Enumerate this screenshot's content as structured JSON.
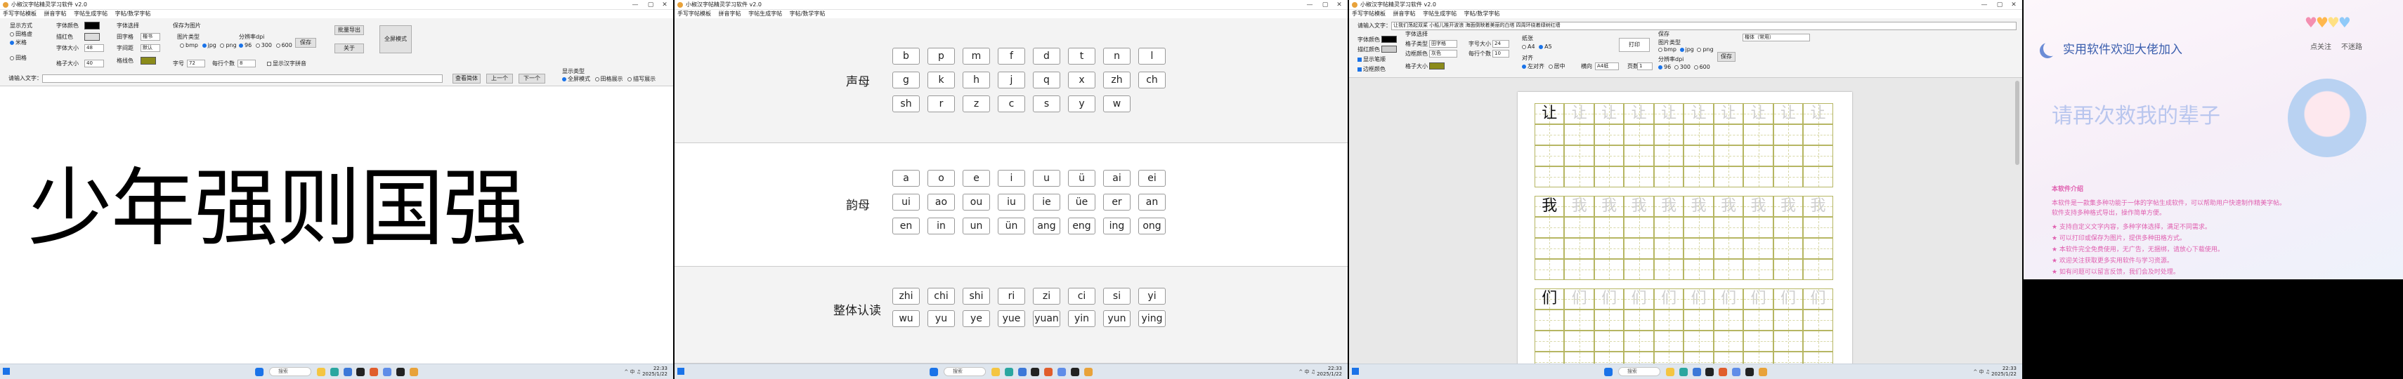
{
  "colors": {
    "accent": "#1a73e8",
    "swatch_black": "#000000",
    "swatch_olive": "#8b8b1a",
    "grid_line": "#b6b663",
    "poster_pink": "#e060b0",
    "poster_blue": "#6b8cd6"
  },
  "window": {
    "title": "小椒汉字帖精灵学习软件 v2.0",
    "min": "—",
    "max": "▢",
    "close": "✕"
  },
  "menu": [
    "手写字帖模板",
    "拼音字帖",
    "字帖生成字帖",
    "字帖/数学字帖"
  ],
  "taskbar": {
    "search": "搜索",
    "time": "22:33",
    "date": "2025/1/22",
    "tray": "^ 中 ♫"
  },
  "p1": {
    "font_style_label": "显示方式",
    "opt1": "田格虚",
    "opt2": "米格",
    "opt3": "田格",
    "opt4": "横线",
    "opt5": "方格",
    "color_label": "字体颜色",
    "border_color_label": "描红色",
    "size_label": "字体大小",
    "grid_size_label": "格子大小",
    "grid_color_label": "格线色",
    "font_label": "字体选择",
    "font_value": "楷书",
    "spacing_label": "字间距",
    "spacing_value": "默认",
    "chars_label": "字数",
    "font_size_value": "48",
    "grid_size_value": "40",
    "mode_label": "田字格",
    "trace_label": "描红数量",
    "export_label": "保存为图片",
    "fmt_label": "图片类型",
    "fmt1": "bmp",
    "fmt2": "jpg",
    "fmt3": "png",
    "res_label": "分辨率dpi",
    "res1": "96",
    "res2": "300",
    "res3": "600",
    "pages_label": "字号",
    "pages_value": "72",
    "lines_label": "每行个数",
    "lines_value": "8",
    "show_pinyin": "显示汉字拼音",
    "btn_save": "保存",
    "btn_batch": "批量导出",
    "btn_about": "关于",
    "btn_fullscreen": "全屏模式",
    "input_label": "请输入文字：",
    "input_value": "",
    "btn_search": "查看简体",
    "btn_prev": "上一个",
    "btn_next": "下一个",
    "display_label": "显示类型",
    "disp1": "全屏模式",
    "disp2": "田格展示",
    "disp3": "描写展示",
    "big_text": "少年强则国强"
  },
  "p2": {
    "title": "小椒汉字帖精灵学习软件 v2.0",
    "menu": [
      "手写字帖模板",
      "拼音字帖",
      "字帖生成字帖",
      "字帖/数学字帖"
    ],
    "shengmu_label": "声母",
    "shengmu": [
      "b",
      "p",
      "m",
      "f",
      "d",
      "t",
      "n",
      "l",
      "g",
      "k",
      "h",
      "j",
      "q",
      "x",
      "zh",
      "ch",
      "sh",
      "r",
      "z",
      "c",
      "s",
      "y",
      "w"
    ],
    "yunmu_label": "韵母",
    "yunmu": [
      "a",
      "o",
      "e",
      "i",
      "u",
      "ü",
      "ai",
      "ei",
      "ui",
      "ao",
      "ou",
      "iu",
      "ie",
      "üe",
      "er",
      "an",
      "en",
      "in",
      "un",
      "ün",
      "ang",
      "eng",
      "ing",
      "ong"
    ],
    "zhengti_label": "整体认读",
    "zhengti": [
      "zhi",
      "chi",
      "shi",
      "ri",
      "zi",
      "ci",
      "si",
      "yi",
      "wu",
      "yu",
      "ye",
      "yue",
      "yuan",
      "yin",
      "yun",
      "ying"
    ]
  },
  "p3": {
    "title": "小椒汉字帖精灵学习软件 v2.0",
    "menu": [
      "手写字帖模板",
      "拼音字帖",
      "字帖生成字帖",
      "字帖/数学字帖"
    ],
    "input_label": "请输入文字：",
    "input_value": "让我们荡起双桨 小船儿推开波浪 海面倒映着美丽的白塔 四周环绕着绿树红墙",
    "color_label": "字体颜色",
    "trace_label": "描红颜色",
    "trace_value": "灰色",
    "border_label": "边框颜色",
    "font_label": "字体选择",
    "font_value": "楷体",
    "grid_type_label": "格子类型",
    "grid_type_value": "田字格",
    "char_size_label": "字号大小",
    "char_size_value": "24",
    "grid_size_label": "格子大小",
    "grid_size_value": "40",
    "lines_label": "每行个数",
    "lines_value": "10",
    "pages_label": "页数",
    "pages_value": "1",
    "trace_count_label": "描红数量",
    "trace_count_value": "9",
    "print_btn": "打印",
    "export_label": "保存",
    "fmt_label": "图片类型",
    "fmt1": "bmp",
    "fmt2": "jpg",
    "fmt3": "png",
    "res_label": "分辨率dpi",
    "res1": "96",
    "res2": "300",
    "res3": "600",
    "save_btn": "保存",
    "align_label": "对齐",
    "align1": "左对齐",
    "align2": "居中",
    "mode_label": "显示笔顺",
    "paper_label": "纸张",
    "paper1": "A4",
    "paper2": "A5",
    "paper_size_label": "横向",
    "paper_size_value": "A4纸",
    "extra": "楷体（常用）",
    "rows": [
      {
        "char": "让",
        "trace": "让"
      },
      {
        "char": "我",
        "trace": "我"
      },
      {
        "char": "们",
        "trace": "们"
      }
    ]
  },
  "p4": {
    "title": "实用软件欢迎大佬加入",
    "subtitle": "请再次救我的辈子",
    "aside1": "点关注",
    "aside2": "不迷路",
    "lines": [
      "本软件介绍",
      "本软件是一款集多种功能于一体的字帖生成软件，可以帮助用户快速制作精美字帖。",
      "软件支持多种格式导出，操作简单方便。",
      "★ 支持自定义文字内容，多种字体选择，满足不同需求。",
      "★ 可以打印或保存为图片，提供多种田格方式。",
      "★ 本软件完全免费使用，无广告，无捆绑，请放心下载使用。",
      "★ 欢迎关注获取更多实用软件与学习资源。",
      "★ 如有问题可以留言反馈，我们会及时处理。"
    ]
  }
}
